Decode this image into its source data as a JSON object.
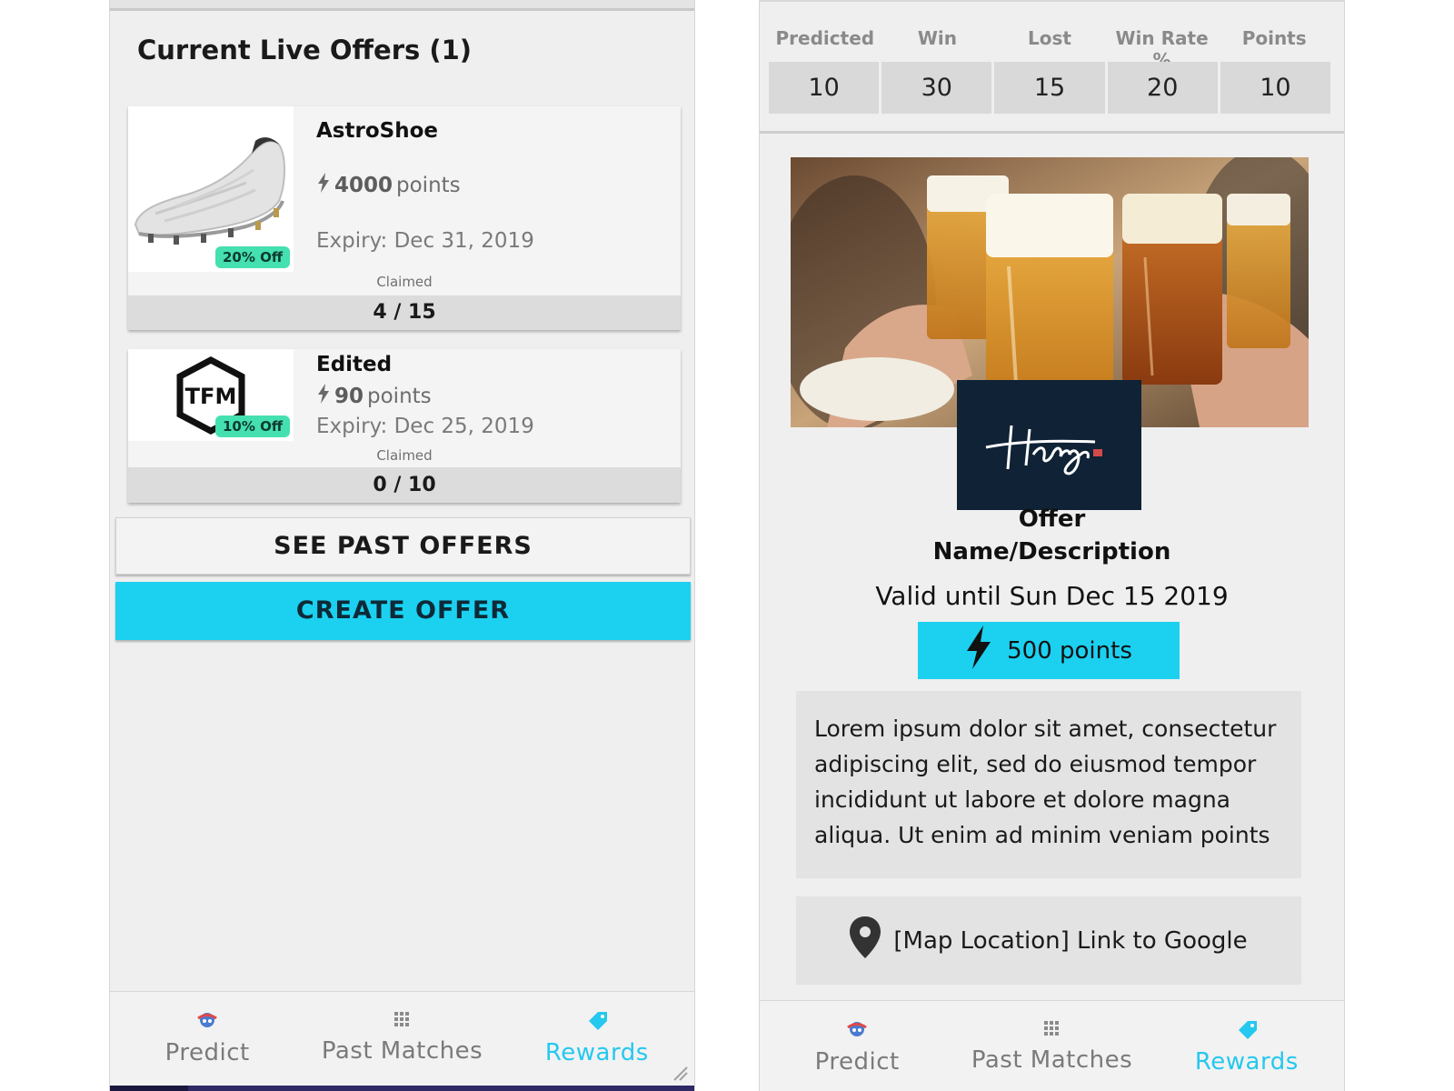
{
  "left": {
    "title": "Current Live Offers (1)",
    "offers": [
      {
        "name": "AstroShoe",
        "points": "4000",
        "points_unit": "points",
        "expiry": "Expiry: Dec 31, 2019",
        "discount": "20% Off",
        "claimed_label": "Claimed",
        "claimed": "4 / 15",
        "image": "shoe-image"
      },
      {
        "name": "Edited",
        "points": "90",
        "points_unit": "points",
        "expiry": "Expiry: Dec 25, 2019",
        "discount": "10% Off",
        "claimed_label": "Claimed",
        "claimed": "0 / 10",
        "image": "tfm-logo",
        "logo_text": "TFM"
      }
    ],
    "see_past_label": "SEE PAST OFFERS",
    "create_label": "CREATE OFFER"
  },
  "nav": {
    "items": [
      {
        "label": "Predict",
        "icon": "predict-icon"
      },
      {
        "label": "Past Matches",
        "icon": "grid-icon"
      },
      {
        "label": "Rewards",
        "icon": "tag-icon",
        "active": true
      }
    ]
  },
  "right": {
    "stats_headers": [
      "Predicted",
      "Win",
      "Lost",
      "Win Rate %",
      "Points"
    ],
    "stats_values": [
      "10",
      "30",
      "15",
      "20",
      "10"
    ],
    "hero_image": "beer-glasses-toast",
    "brand_logo": "harrys-logo",
    "offer_title_line1": "Offer",
    "offer_title_line2": "Name/Description",
    "valid_until": "Valid until Sun Dec 15 2019",
    "points_label": "500 points",
    "description": "Lorem ipsum dolor sit amet, consectetur adipiscing elit, sed do eiusmod tempor incididunt ut labore et dolore magna aliqua. Ut enim ad minim veniam points",
    "map_link": "[Map Location] Link to Google"
  },
  "colors": {
    "accent": "#1cd0f0",
    "badge": "#45e0b0",
    "active_nav": "#25c8ee",
    "logo_bg": "#102235"
  }
}
